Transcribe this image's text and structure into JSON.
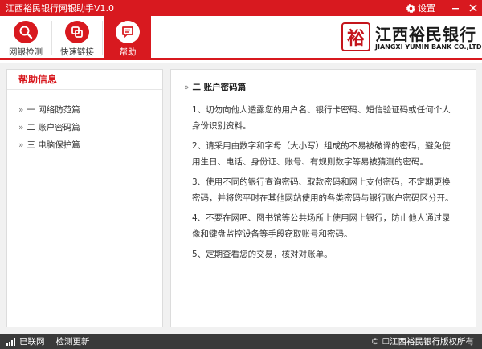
{
  "window": {
    "title": "江西裕民银行网银助手V1.0",
    "settings_label": "设置"
  },
  "toolbar": {
    "items": [
      {
        "label": "网银检测",
        "icon": "magnifier-icon"
      },
      {
        "label": "快速链接",
        "icon": "link-icon"
      },
      {
        "label": "帮助",
        "icon": "chat-icon",
        "active": true
      }
    ]
  },
  "logo": {
    "seal_char": "裕",
    "name": "江西裕民银行",
    "english": "JIANGXI YUMIN BANK CO.,LTD."
  },
  "sidebar": {
    "heading": "帮助信息",
    "items": [
      {
        "label": "一 网络防范篇"
      },
      {
        "label": "二 账户密码篇"
      },
      {
        "label": "三 电脑保护篇"
      }
    ]
  },
  "article": {
    "title": "二 账户密码篇",
    "paragraphs": [
      "1、切勿向他人透露您的用户名、银行卡密码、短信验证码或任何个人身份识别资料。",
      "2、请采用由数字和字母（大小写）组成的不易被破译的密码，避免使用生日、电话、身份证、账号、有规则数字等易被猜测的密码。",
      "3、使用不同的银行查询密码、取款密码和网上支付密码，不定期更换密码，并将您平时在其他网站使用的各类密码与银行账户密码区分开。",
      "4、不要在网吧、图书馆等公共场所上使用网上银行，防止他人通过录像和键盘监控设备等手段窃取账号和密码。",
      "5、定期查看您的交易，核对对账单。"
    ]
  },
  "status": {
    "network": "已联网",
    "check_update": "检测更新",
    "copyright": "© ☐江西裕民银行版权所有"
  },
  "colors": {
    "brand_red": "#d8191f",
    "status_bg": "#3a3a3a",
    "content_bg": "#f1f1f1"
  }
}
